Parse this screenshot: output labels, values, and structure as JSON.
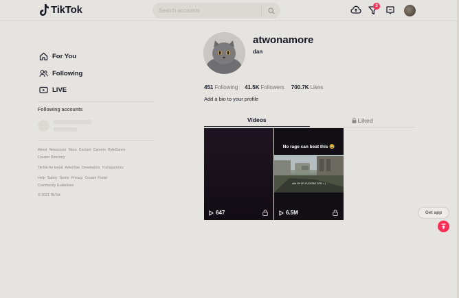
{
  "header": {
    "logo_text": "TikTok",
    "search_placeholder": "Search accounts",
    "inbox_badge": "3"
  },
  "sidebar": {
    "nav": [
      {
        "label": "For You",
        "icon": "home-icon"
      },
      {
        "label": "Following",
        "icon": "users-icon"
      },
      {
        "label": "LIVE",
        "icon": "live-icon"
      }
    ],
    "following_heading": "Following accounts",
    "footer_rows": [
      [
        "About",
        "Newsroom",
        "Store",
        "Contact",
        "Careers",
        "ByteDance"
      ],
      [
        "Creator Directory"
      ],
      [
        "TikTok for Good",
        "Advertise",
        "Developers",
        "Transparency"
      ],
      [
        "Help",
        "Safety",
        "Terms",
        "Privacy",
        "Creator Portal"
      ],
      [
        "Community Guidelines"
      ]
    ],
    "copyright": "© 2021 TikTok"
  },
  "profile": {
    "username": "atwonamore",
    "nickname": "dan",
    "following_count": "451",
    "following_label": "Following",
    "followers_count": "41.5K",
    "followers_label": "Followers",
    "likes_count": "700.7K",
    "likes_label": "Likes",
    "bio": "Add a bio to your profile"
  },
  "tabs": {
    "videos": "Videos",
    "liked": "Liked"
  },
  "videos": [
    {
      "views": "647",
      "caption": ""
    },
    {
      "views": "6.5M",
      "caption": "No rage can beat this 😂",
      "subtitle": "ahh OH MY FUCKING GOD < |"
    }
  ],
  "floating": {
    "get_app": "Get app"
  },
  "colors": {
    "accent": "#fe2c55",
    "background": "#e6e4e0",
    "text": "#161823"
  }
}
